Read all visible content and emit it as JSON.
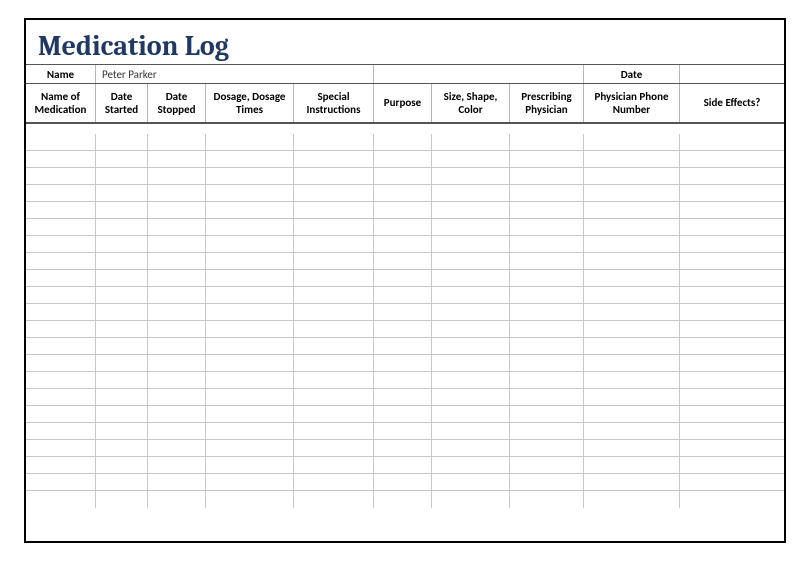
{
  "title": "Medication Log",
  "info": {
    "name_label": "Name",
    "name_value": "Peter Parker",
    "date_label": "Date",
    "date_value": ""
  },
  "columns": [
    "Name of Medication",
    "Date Started",
    "Date Stopped",
    "Dosage, Dosage Times",
    "Special Instructions",
    "Purpose",
    "Size, Shape, Color",
    "Prescribing Physician",
    "Physician Phone Number",
    "Side Effects?"
  ],
  "rows": [
    [
      "",
      "",
      "",
      "",
      "",
      "",
      "",
      "",
      "",
      ""
    ],
    [
      "",
      "",
      "",
      "",
      "",
      "",
      "",
      "",
      "",
      ""
    ],
    [
      "",
      "",
      "",
      "",
      "",
      "",
      "",
      "",
      "",
      ""
    ],
    [
      "",
      "",
      "",
      "",
      "",
      "",
      "",
      "",
      "",
      ""
    ],
    [
      "",
      "",
      "",
      "",
      "",
      "",
      "",
      "",
      "",
      ""
    ],
    [
      "",
      "",
      "",
      "",
      "",
      "",
      "",
      "",
      "",
      ""
    ],
    [
      "",
      "",
      "",
      "",
      "",
      "",
      "",
      "",
      "",
      ""
    ],
    [
      "",
      "",
      "",
      "",
      "",
      "",
      "",
      "",
      "",
      ""
    ],
    [
      "",
      "",
      "",
      "",
      "",
      "",
      "",
      "",
      "",
      ""
    ],
    [
      "",
      "",
      "",
      "",
      "",
      "",
      "",
      "",
      "",
      ""
    ],
    [
      "",
      "",
      "",
      "",
      "",
      "",
      "",
      "",
      "",
      ""
    ],
    [
      "",
      "",
      "",
      "",
      "",
      "",
      "",
      "",
      "",
      ""
    ],
    [
      "",
      "",
      "",
      "",
      "",
      "",
      "",
      "",
      "",
      ""
    ],
    [
      "",
      "",
      "",
      "",
      "",
      "",
      "",
      "",
      "",
      ""
    ],
    [
      "",
      "",
      "",
      "",
      "",
      "",
      "",
      "",
      "",
      ""
    ],
    [
      "",
      "",
      "",
      "",
      "",
      "",
      "",
      "",
      "",
      ""
    ],
    [
      "",
      "",
      "",
      "",
      "",
      "",
      "",
      "",
      "",
      ""
    ],
    [
      "",
      "",
      "",
      "",
      "",
      "",
      "",
      "",
      "",
      ""
    ],
    [
      "",
      "",
      "",
      "",
      "",
      "",
      "",
      "",
      "",
      ""
    ],
    [
      "",
      "",
      "",
      "",
      "",
      "",
      "",
      "",
      "",
      ""
    ],
    [
      "",
      "",
      "",
      "",
      "",
      "",
      "",
      "",
      "",
      ""
    ],
    [
      "",
      "",
      "",
      "",
      "",
      "",
      "",
      "",
      "",
      ""
    ]
  ]
}
